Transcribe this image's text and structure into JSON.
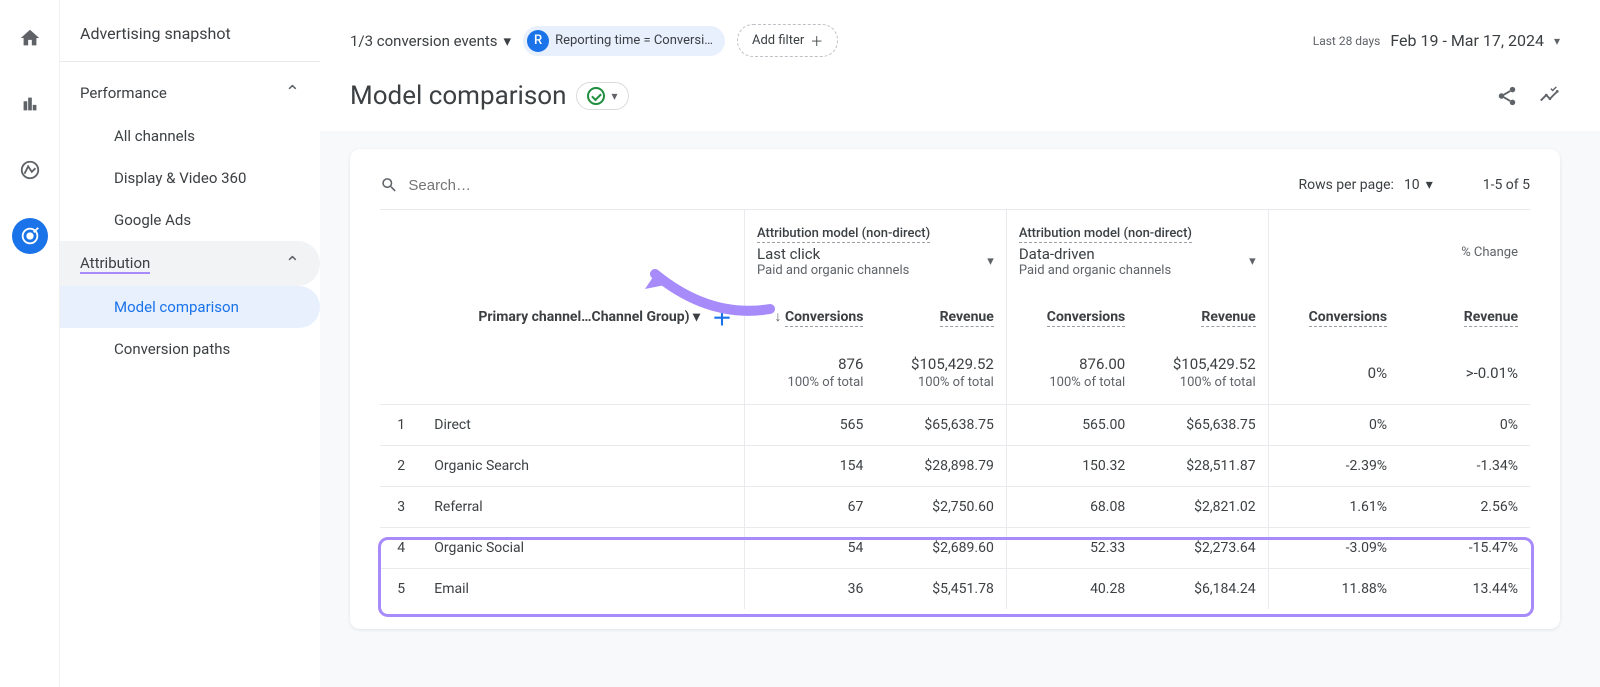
{
  "sidebar": {
    "title": "Advertising snapshot",
    "sections": [
      {
        "label": "Performance",
        "items": [
          "All channels",
          "Display & Video 360",
          "Google Ads"
        ]
      },
      {
        "label": "Attribution",
        "items": [
          "Model comparison",
          "Conversion paths"
        ]
      }
    ]
  },
  "topbar": {
    "conversion_events": "1/3 conversion events",
    "chip_avatar": "R",
    "chip_text": "Reporting time = Conversi…",
    "add_filter": "Add filter",
    "date_label": "Last 28 days",
    "date_value": "Feb 19 - Mar 17, 2024"
  },
  "page": {
    "title": "Model comparison"
  },
  "table": {
    "search_placeholder": "Search…",
    "rows_per_page_label": "Rows per page:",
    "rows_per_page_value": "10",
    "page_info": "1-5 of 5",
    "group_header": "Attribution model (non-direct)",
    "model_a": {
      "name": "Last click",
      "sub": "Paid and organic channels"
    },
    "model_b": {
      "name": "Data-driven",
      "sub": "Paid and organic channels"
    },
    "change_header": "% Change",
    "primary_dimension": "Primary channel…Channel Group)",
    "col_conversions": "Conversions",
    "col_revenue": "Revenue",
    "totals": {
      "a_conv": "876",
      "a_conv_sub": "100% of total",
      "a_rev": "$105,429.52",
      "a_rev_sub": "100% of total",
      "b_conv": "876.00",
      "b_conv_sub": "100% of total",
      "b_rev": "$105,429.52",
      "b_rev_sub": "100% of total",
      "chg_conv": "0%",
      "chg_rev": ">-0.01%"
    },
    "rows": [
      {
        "n": "1",
        "channel": "Direct",
        "a_conv": "565",
        "a_rev": "$65,638.75",
        "b_conv": "565.00",
        "b_rev": "$65,638.75",
        "chg_conv": "0%",
        "chg_rev": "0%"
      },
      {
        "n": "2",
        "channel": "Organic Search",
        "a_conv": "154",
        "a_rev": "$28,898.79",
        "b_conv": "150.32",
        "b_rev": "$28,511.87",
        "chg_conv": "-2.39%",
        "chg_rev": "-1.34%"
      },
      {
        "n": "3",
        "channel": "Referral",
        "a_conv": "67",
        "a_rev": "$2,750.60",
        "b_conv": "68.08",
        "b_rev": "$2,821.02",
        "chg_conv": "1.61%",
        "chg_rev": "2.56%"
      },
      {
        "n": "4",
        "channel": "Organic Social",
        "a_conv": "54",
        "a_rev": "$2,689.60",
        "b_conv": "52.33",
        "b_rev": "$2,273.64",
        "chg_conv": "-3.09%",
        "chg_rev": "-15.47%"
      },
      {
        "n": "5",
        "channel": "Email",
        "a_conv": "36",
        "a_rev": "$5,451.78",
        "b_conv": "40.28",
        "b_rev": "$6,184.24",
        "chg_conv": "11.88%",
        "chg_rev": "13.44%"
      }
    ]
  }
}
